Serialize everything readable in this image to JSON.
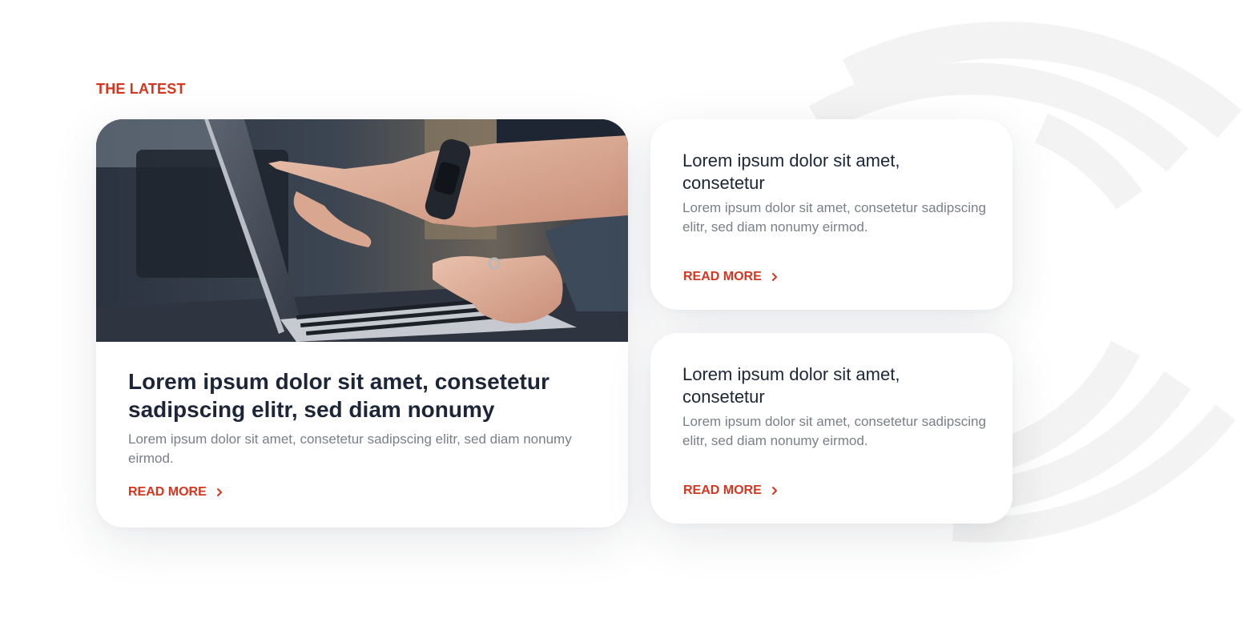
{
  "section": {
    "label": "THE LATEST"
  },
  "featured": {
    "image_alt": "Hands pointing at a laptop screen",
    "title": "Lorem ipsum dolor sit amet, consetetur sadipscing elitr, sed diam nonumy",
    "excerpt": "Lorem ipsum dolor sit amet, consetetur sadipscing elitr, sed diam nonumy eirmod.",
    "read_more": "READ MORE"
  },
  "side_cards": [
    {
      "title": "Lorem ipsum dolor sit amet, consetetur",
      "excerpt": "Lorem ipsum dolor sit amet, consetetur sadipscing elitr, sed diam nonumy eirmod.",
      "read_more": "READ MORE"
    },
    {
      "title": "Lorem ipsum dolor sit amet, consetetur",
      "excerpt": "Lorem ipsum dolor sit amet, consetetur sadipscing elitr, sed diam nonumy eirmod.",
      "read_more": "READ MORE"
    }
  ],
  "colors": {
    "accent": "#d4361f",
    "heading": "#1c2638",
    "body_text": "#7a7f87",
    "background_arc": "#f4f4f4"
  },
  "icons": {
    "read_more": "chevron-right-icon"
  }
}
